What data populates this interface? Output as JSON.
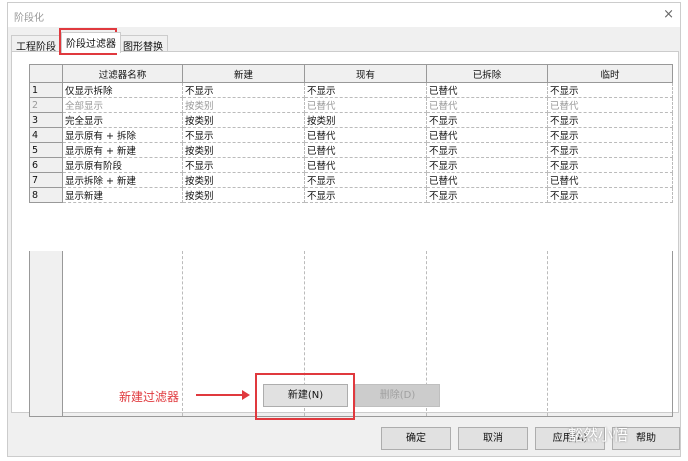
{
  "window": {
    "title": "阶段化",
    "close_icon": "×"
  },
  "tabs": [
    {
      "label": "工程阶段"
    },
    {
      "label": "阶段过滤器"
    },
    {
      "label": "图形替换"
    }
  ],
  "table": {
    "headers": [
      "过滤器名称",
      "新建",
      "现有",
      "已拆除",
      "临时"
    ],
    "rows": [
      {
        "num": "1",
        "cells": [
          "仅显示拆除",
          "不显示",
          "不显示",
          "已替代",
          "不显示"
        ]
      },
      {
        "num": "2",
        "cells": [
          "全部显示",
          "按类别",
          "已替代",
          "已替代",
          "已替代"
        ]
      },
      {
        "num": "3",
        "cells": [
          "完全显示",
          "按类别",
          "按类别",
          "不显示",
          "不显示"
        ]
      },
      {
        "num": "4",
        "cells": [
          "显示原有 + 拆除",
          "不显示",
          "已替代",
          "已替代",
          "不显示"
        ]
      },
      {
        "num": "5",
        "cells": [
          "显示原有 + 新建",
          "按类别",
          "已替代",
          "不显示",
          "不显示"
        ]
      },
      {
        "num": "6",
        "cells": [
          "显示原有阶段",
          "不显示",
          "已替代",
          "不显示",
          "不显示"
        ]
      },
      {
        "num": "7",
        "cells": [
          "显示拆除 + 新建",
          "按类别",
          "不显示",
          "已替代",
          "已替代"
        ]
      },
      {
        "num": "8",
        "cells": [
          "显示新建",
          "按类别",
          "不显示",
          "不显示",
          "不显示"
        ]
      }
    ]
  },
  "buttons": {
    "new": "新建(N)",
    "delete": "删除(D)",
    "ok": "确定",
    "cancel": "取消",
    "apply": "应用(A)",
    "help": "帮助"
  },
  "annotation": {
    "text": "新建过滤器",
    "color": "#e0393e"
  },
  "watermark": "豁然小悟"
}
